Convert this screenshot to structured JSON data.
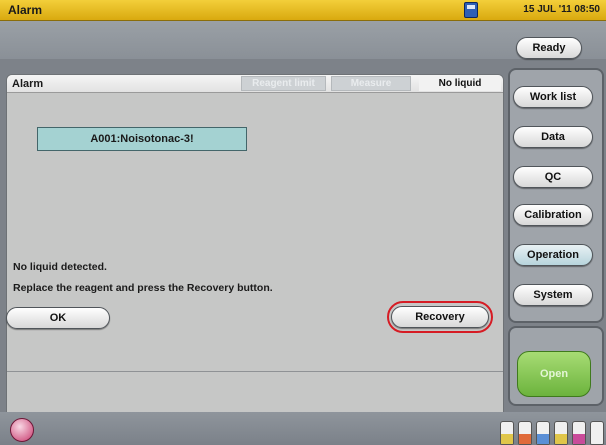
{
  "topbar": {
    "title": "Alarm",
    "datetime": "15 JUL '11 08:50"
  },
  "status": {
    "ready_label": "Ready"
  },
  "panel": {
    "title": "Alarm",
    "tabs": [
      {
        "label": "Reagent limit",
        "state": "dim"
      },
      {
        "label": "Measure",
        "state": "dim"
      },
      {
        "label": "No liquid",
        "state": "active"
      }
    ],
    "alarm_code": "A001:Noisotonac-3!",
    "message_line1": "No liquid detected.",
    "message_line2": "Replace the reagent and press the Recovery button.",
    "ok_label": "OK",
    "recovery_label": "Recovery"
  },
  "sidebar": {
    "items": [
      {
        "label": "Work list"
      },
      {
        "label": "Data"
      },
      {
        "label": "QC"
      },
      {
        "label": "Calibration"
      },
      {
        "label": "Operation"
      },
      {
        "label": "System"
      }
    ],
    "open_label": "Open"
  },
  "colors": {
    "topbar": "#f3cf3a",
    "highlight_ring": "#d61c24",
    "open_button": "#8ac95a",
    "code_box": "#a4d2d2"
  },
  "icons": [
    "memory-card-icon",
    "logo-icon",
    "reagent-bottle-icon"
  ]
}
